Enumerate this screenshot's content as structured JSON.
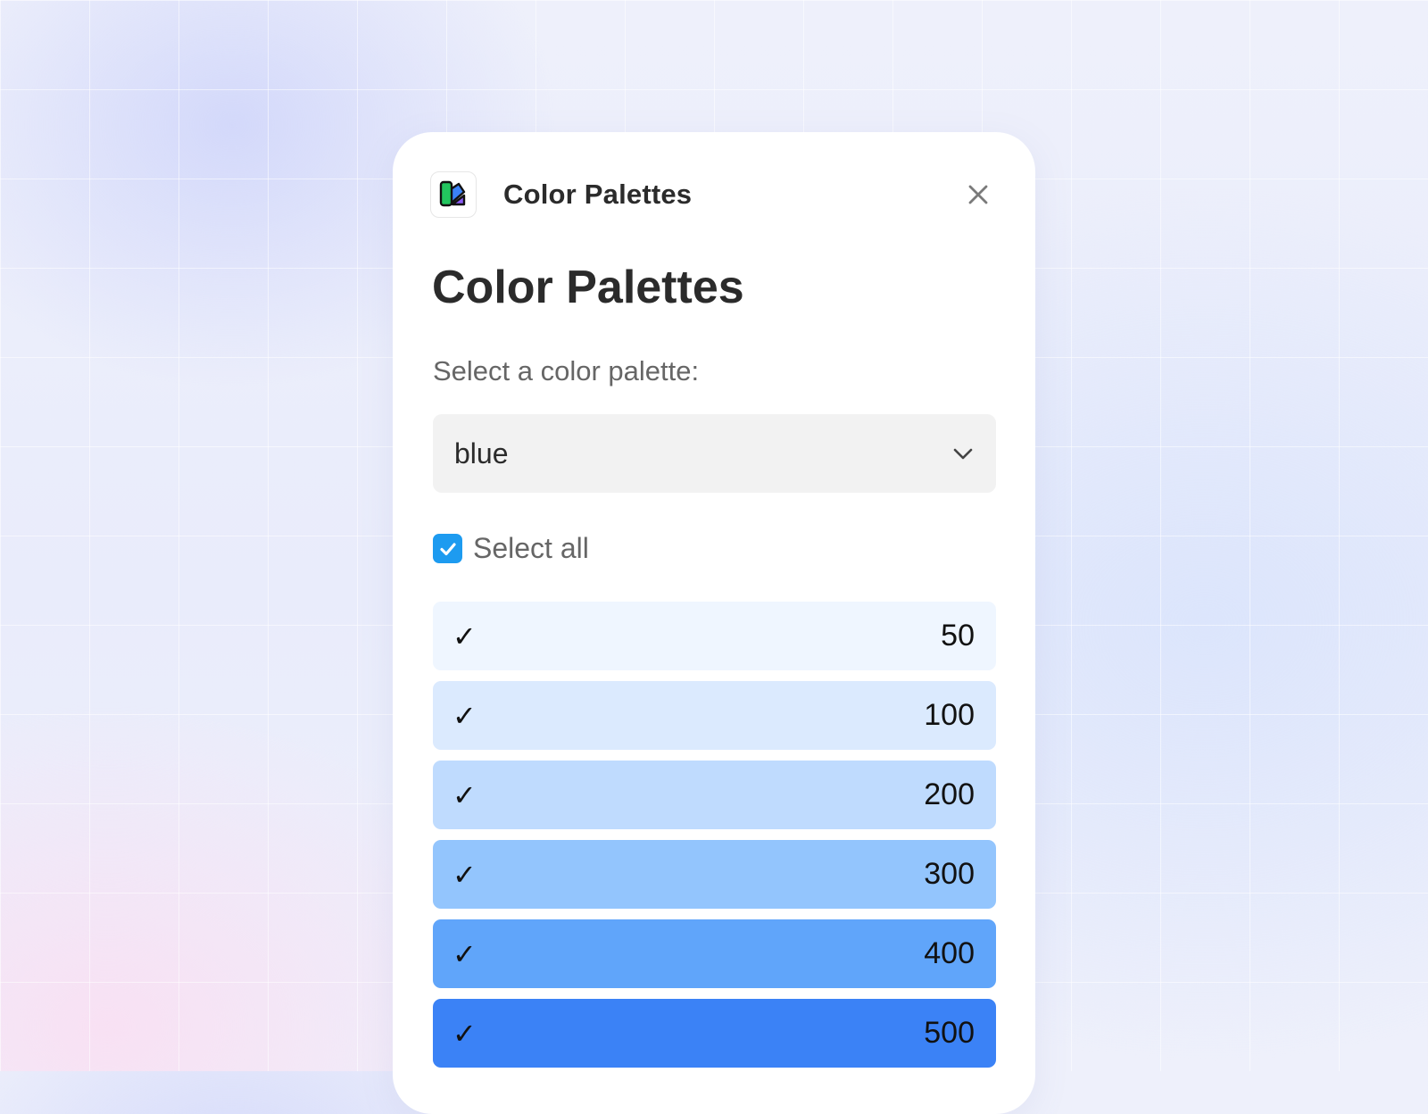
{
  "header": {
    "title": "Color Palettes",
    "app_icon": "color-palettes-swatch-icon",
    "close_icon": "close-icon"
  },
  "main": {
    "title": "Color Palettes",
    "select_label": "Select a color palette:",
    "palette_select": {
      "value": "blue",
      "icon": "chevron-down-icon"
    },
    "select_all": {
      "label": "Select all",
      "checked": true,
      "color": "#1d9bf0"
    },
    "shades": [
      {
        "label": "50",
        "checked": true,
        "color": "#eff6ff"
      },
      {
        "label": "100",
        "checked": true,
        "color": "#dbeafe"
      },
      {
        "label": "200",
        "checked": true,
        "color": "#bfdbfe"
      },
      {
        "label": "300",
        "checked": true,
        "color": "#93c5fd"
      },
      {
        "label": "400",
        "checked": true,
        "color": "#60a5fa"
      },
      {
        "label": "500",
        "checked": true,
        "color": "#3b82f6"
      }
    ],
    "check_glyph": "✓"
  }
}
